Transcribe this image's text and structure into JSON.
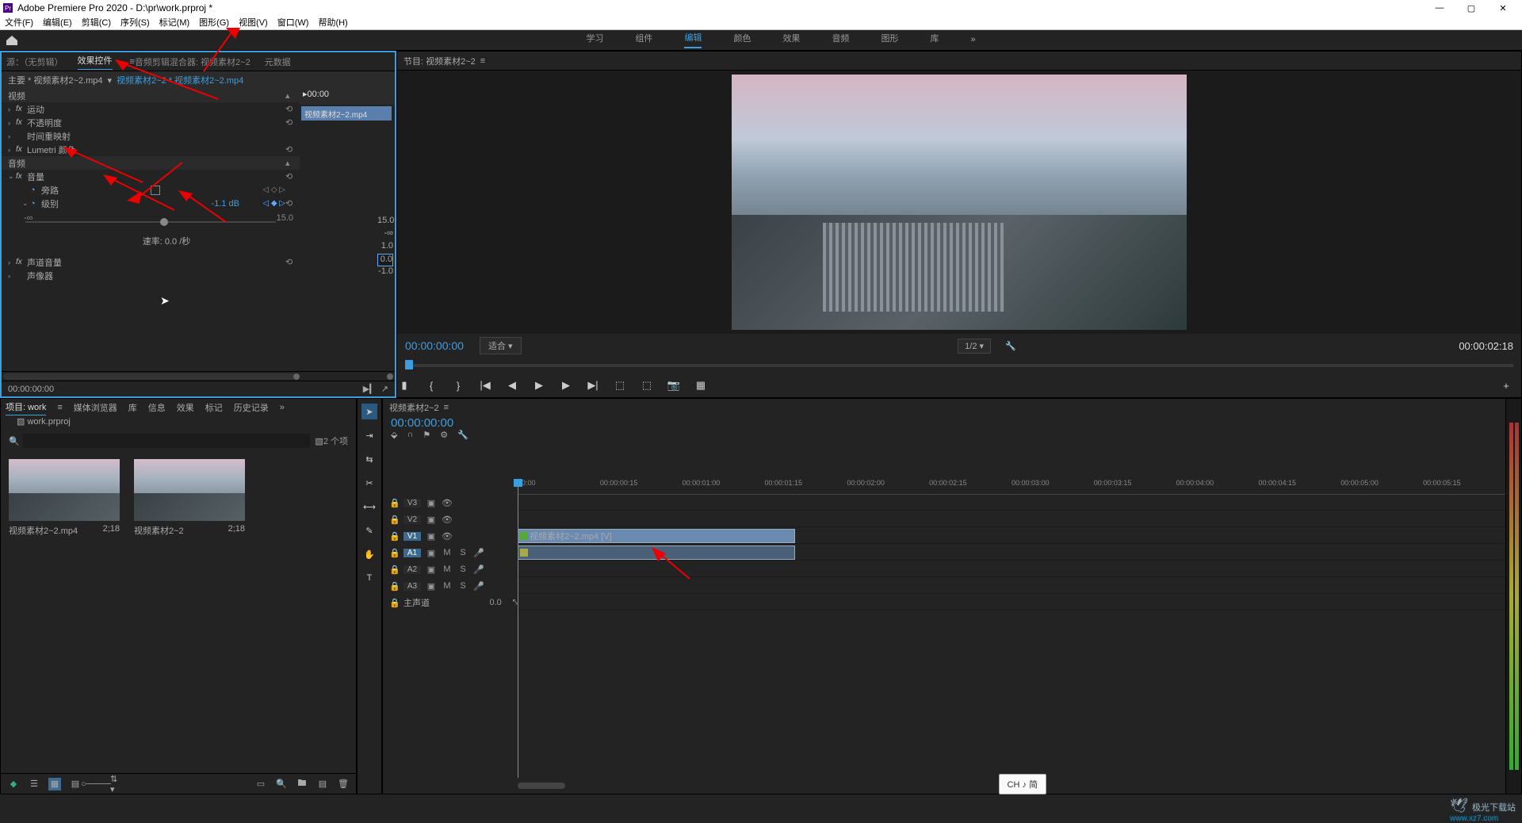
{
  "app": {
    "title": "Adobe Premiere Pro 2020 - D:\\pr\\work.prproj *"
  },
  "menu": {
    "file": "文件(F)",
    "edit": "编辑(E)",
    "clip": "剪辑(C)",
    "sequence": "序列(S)",
    "mark": "标记(M)",
    "graphics": "图形(G)",
    "view": "视图(V)",
    "window": "窗口(W)",
    "help": "帮助(H)"
  },
  "workspaces": {
    "learn": "学习",
    "assembly": "组件",
    "edit": "编辑",
    "color": "颜色",
    "effects": "效果",
    "audio": "音频",
    "graphics": "图形",
    "lib": "库",
    "more": "»"
  },
  "source_tabs": {
    "source": "源：（无剪辑）",
    "ec": "效果控件",
    "mixer": "音频剪辑混合器: 视频素材2~2",
    "meta": "元数据",
    "menu": "≡"
  },
  "ec": {
    "master_label": "主要 * 视频素材2~2.mp4",
    "path_label": "视频素材2~2 * 视频素材2~2.mp4",
    "start_tc": "▸00:00",
    "clip_name": "视频素材2~2.mp4",
    "video_section": "视频",
    "motion": "运动",
    "opacity": "不透明度",
    "timeremap": "时间重映射",
    "lumetri": "Lumetri 颜色",
    "audio_section": "音频",
    "volume": "音量",
    "bypass": "旁路",
    "level": "级别",
    "level_val": "-1.1 dB",
    "slider_min": "-∞",
    "slider_max": "15.0",
    "rate": "速率: 0.0 /秒",
    "channel_vol": "声道音量",
    "panner": "声像器",
    "tc": "00:00:00:00",
    "scale": {
      "a": "15.0",
      "b": "-∞",
      "c": "1.0",
      "d": "0.0",
      "e": "-1.0"
    }
  },
  "program": {
    "tab": "节目: 视频素材2~2",
    "menu": "≡",
    "tc": "00:00:00:00",
    "fit": "适合",
    "ratio": "1/2",
    "duration": "00:00:02:18"
  },
  "transport": {
    "mark": "▮",
    "in": "{",
    "out": "}",
    "gostart": "|◀",
    "stepback": "◀",
    "play": "▶",
    "stepfwd": "▶",
    "goend": "▶|",
    "lift": "⬚",
    "extract": "⬚",
    "export": "📷",
    "cam": "▦",
    "add": "+"
  },
  "project": {
    "tab_project": "项目: work",
    "tab_media": "媒体浏览器",
    "tab_lib": "库",
    "tab_info": "信息",
    "tab_effects": "效果",
    "tab_markers": "标记",
    "tab_history": "历史记录",
    "more": "»",
    "file": "work.prproj",
    "count": "2 个项",
    "item1": {
      "name": "视频素材2~2.mp4",
      "dur": "2;18"
    },
    "item2": {
      "name": "视频素材2~2",
      "dur": "2;18"
    }
  },
  "timeline": {
    "tab": "视频素材2~2",
    "menu": "≡",
    "tc": "00:00:00:00",
    "ticks": [
      "00:00",
      "00:00:00:15",
      "00:00:01:00",
      "00:00:01:15",
      "00:00:02:00",
      "00:00:02:15",
      "00:00:03:00",
      "00:00:03:15",
      "00:00:04:00",
      "00:00:04:15",
      "00:00:05:00",
      "00:00:05:15"
    ],
    "v3": "V3",
    "v2": "V2",
    "v1": "V1",
    "a1": "A1",
    "a2": "A2",
    "a3": "A3",
    "master": "主声道",
    "master_val": "0.0",
    "clip_v": "视频素材2~2.mp4 [V]",
    "m": "M",
    "s": "S"
  },
  "ime": "CH ♪ 简",
  "wm": {
    "a": "极光下载站",
    "b": "www.xz7.com"
  }
}
